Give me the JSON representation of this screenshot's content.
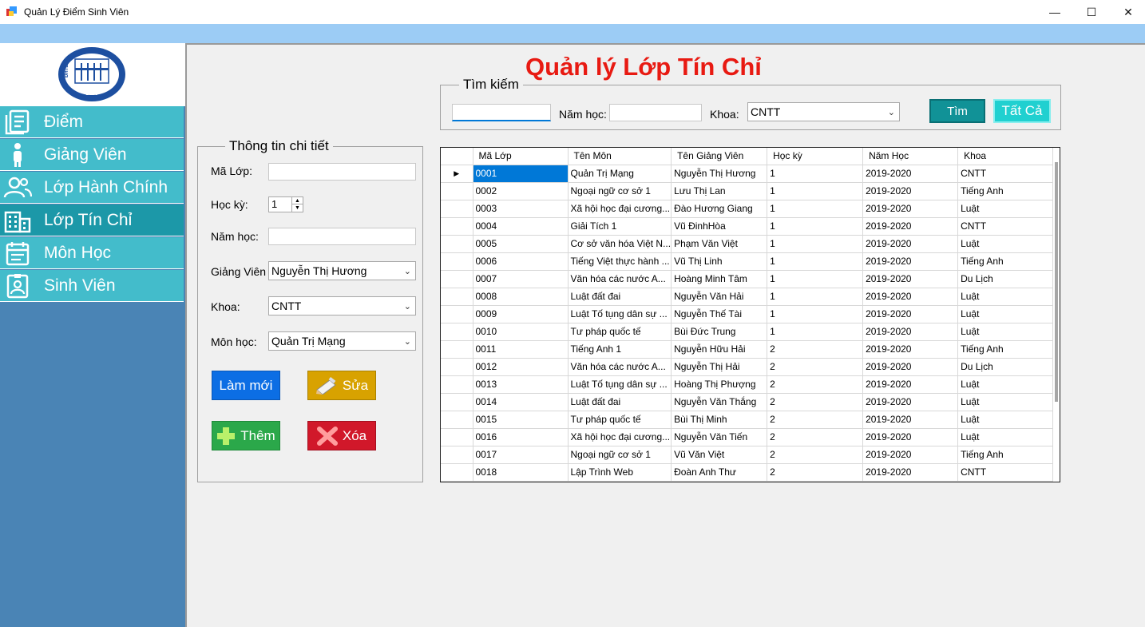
{
  "window": {
    "title": "Quản Lý Điểm Sinh Viên",
    "min": "—",
    "max": "☐",
    "close": "✕"
  },
  "logo": {
    "text": "ĐHTL",
    "year": "1959"
  },
  "sidebar": {
    "items": [
      {
        "label": "Điểm",
        "icon": "document-list-icon",
        "active": false
      },
      {
        "label": "Giảng Viên",
        "icon": "person-icon",
        "active": false
      },
      {
        "label": "Lớp Hành Chính",
        "icon": "people-icon",
        "active": false
      },
      {
        "label": "Lớp Tín Chỉ",
        "icon": "building-icon",
        "active": true
      },
      {
        "label": "Môn Học",
        "icon": "calendar-icon",
        "active": false
      },
      {
        "label": "Sinh Viên",
        "icon": "id-card-icon",
        "active": false
      }
    ]
  },
  "page_title": "Quản lý Lớp Tín Chỉ",
  "search": {
    "legend": "Tìm kiếm",
    "keyword_value": "",
    "nam_hoc_label": "Năm học:",
    "nam_hoc_value": "",
    "khoa_label": "Khoa:",
    "khoa_value": "CNTT",
    "find_button": "Tìm",
    "all_button": "Tất Cả"
  },
  "details": {
    "legend": "Thông tin chi tiết",
    "ma_lop_label": "Mã Lớp:",
    "ma_lop_value": "",
    "hoc_ky_label": "Học kỳ:",
    "hoc_ky_value": "1",
    "nam_hoc_label": "Năm học:",
    "nam_hoc_value": "",
    "giang_vien_label": "Giảng Viên",
    "giang_vien_value": "Nguyễn Thị Hương",
    "khoa_label": "Khoa:",
    "khoa_value": "CNTT",
    "mon_hoc_label": "Môn học:",
    "mon_hoc_value": "Quản Trị Mạng",
    "buttons": {
      "refresh": "Làm mới",
      "edit": "Sửa",
      "add": "Thêm",
      "delete": "Xóa"
    }
  },
  "colors": {
    "title_red": "#e81a12",
    "nav_bg": "#43bccb",
    "nav_active": "#1c98a8",
    "sidebar_bg": "#4a84b5",
    "btn_find": "#119297",
    "btn_all": "#20d0d0",
    "btn_refresh": "#0c6ee4",
    "btn_edit": "#d8a200",
    "btn_add": "#2ba84a",
    "btn_delete": "#d1182a"
  },
  "table": {
    "columns": [
      "Mã Lớp",
      "Tên Môn",
      "Tên Giảng Viên",
      "Học kỳ",
      "Năm Học",
      "Khoa"
    ],
    "rows": [
      [
        "0001",
        "Quản Trị Mạng",
        "Nguyễn Thị Hương",
        "1",
        "2019-2020",
        "CNTT"
      ],
      [
        "0002",
        "Ngoại ngữ cơ sở 1",
        "Lưu Thị Lan",
        "1",
        "2019-2020",
        "Tiếng Anh"
      ],
      [
        "0003",
        "Xã hội học đại cương...",
        "Đào Hương Giang",
        "1",
        "2019-2020",
        "Luật"
      ],
      [
        "0004",
        "Giải Tích 1",
        "Vũ ĐinhHòa",
        "1",
        "2019-2020",
        "CNTT"
      ],
      [
        "0005",
        "Cơ sở văn hóa Việt N...",
        "Phạm Văn Việt",
        "1",
        "2019-2020",
        "Luật"
      ],
      [
        "0006",
        "Tiếng Việt thực hành ...",
        "Vũ Thị Linh",
        "1",
        "2019-2020",
        "Tiếng Anh"
      ],
      [
        "0007",
        "Văn hóa các nước A...",
        "Hoàng Minh Tâm",
        "1",
        "2019-2020",
        "Du Lịch"
      ],
      [
        "0008",
        "Luật đất đai",
        "Nguyễn Văn Hải",
        "1",
        "2019-2020",
        "Luật"
      ],
      [
        "0009",
        "Luật Tố tụng dân sự ...",
        "Nguyễn Thế Tài",
        "1",
        "2019-2020",
        "Luật"
      ],
      [
        "0010",
        "Tư pháp quốc tế",
        "Bùi Đức Trung",
        "1",
        "2019-2020",
        "Luật"
      ],
      [
        "0011",
        "Tiếng Anh 1",
        "Nguyễn Hữu Hải",
        "2",
        "2019-2020",
        "Tiếng Anh"
      ],
      [
        "0012",
        "Văn hóa các nước A...",
        "Nguyễn Thị Hải",
        "2",
        "2019-2020",
        "Du Lịch"
      ],
      [
        "0013",
        "Luật Tố tụng dân sự ...",
        "Hoàng Thị Phượng",
        "2",
        "2019-2020",
        "Luật"
      ],
      [
        "0014",
        "Luật đất đai",
        "Nguyễn Văn Thắng",
        "2",
        "2019-2020",
        "Luật"
      ],
      [
        "0015",
        "Tư pháp quốc tế",
        "Bùi Thị Minh",
        "2",
        "2019-2020",
        "Luật"
      ],
      [
        "0016",
        "Xã hội học đại cương...",
        "Nguyễn Văn Tiến",
        "2",
        "2019-2020",
        "Luật"
      ],
      [
        "0017",
        "Ngoại ngữ cơ sở 1",
        "Vũ Văn Việt",
        "2",
        "2019-2020",
        "Tiếng Anh"
      ],
      [
        "0018",
        "Lập Trình Web",
        "Đoàn Anh Thư",
        "2",
        "2019-2020",
        "CNTT"
      ]
    ],
    "selected_row": 0
  }
}
